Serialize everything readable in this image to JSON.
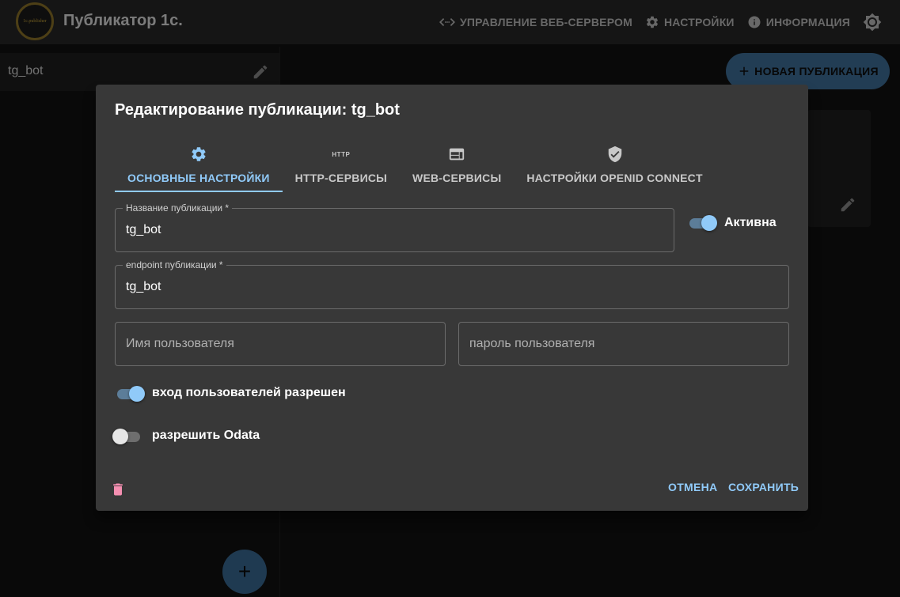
{
  "app": {
    "title": "Публикатор 1с.",
    "logo_text": "1c.publisher"
  },
  "nav": {
    "webserver": "УПРАВЛЕНИЕ ВЕБ-СЕРВЕРОМ",
    "settings": "НАСТРОЙКИ",
    "info": "ИНФОРМАЦИЯ"
  },
  "sidebar": {
    "items": [
      {
        "label": "tg_bot"
      }
    ],
    "fab_label": "+"
  },
  "main": {
    "new_publication_label": "НОВАЯ ПУБЛИКАЦИЯ"
  },
  "dialog": {
    "title": "Редактирование публикации: tg_bot",
    "tabs": [
      {
        "label": "ОСНОВНЫЕ НАСТРОЙКИ",
        "icon": "gear-icon",
        "active": true
      },
      {
        "label": "HTTP-СЕРВИСЫ",
        "icon": "http-icon",
        "icon_text": "HTTP",
        "active": false
      },
      {
        "label": "WEB-СЕРВИСЫ",
        "icon": "web-window-icon",
        "active": false
      },
      {
        "label": "НАСТРОЙКИ OPENID CONNECT",
        "icon": "verified-shield-icon",
        "active": false
      }
    ],
    "fields": {
      "name": {
        "label": "Название публикации *",
        "value": "tg_bot"
      },
      "endpoint": {
        "label": "endpoint публикации *",
        "value": "tg_bot"
      },
      "username": {
        "placeholder": "Имя пользователя",
        "value": ""
      },
      "password": {
        "placeholder": "пароль пользователя",
        "value": ""
      }
    },
    "switches": {
      "active": {
        "label": "Активна",
        "on": true
      },
      "users_login": {
        "label": "вход пользователей разрешен",
        "on": true
      },
      "odata": {
        "label": "разрешить Odata",
        "on": false
      }
    },
    "actions": {
      "cancel": "ОТМЕНА",
      "save": "СОХРАНИТЬ"
    }
  },
  "colors": {
    "accent": "#90caf9",
    "danger": "#f48fb1",
    "dialog_bg": "#383838",
    "appbar_bg": "#272727"
  }
}
